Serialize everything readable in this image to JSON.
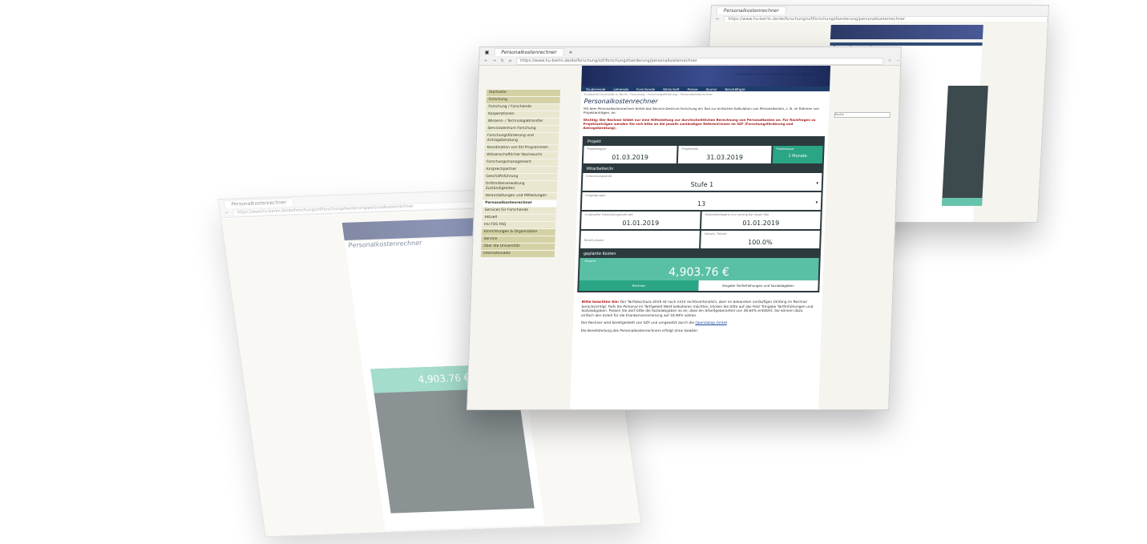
{
  "browser": {
    "tab_title": "Personalkostenrechner",
    "url": "https://www.hu-berlin.de/de/forschung/szf/forschungsfoerderung/personalkostenrechner"
  },
  "site": {
    "university_name": "HUMBOLDT-UNIVERSITÄT ZU BERLIN",
    "top_nav": [
      "Studierende",
      "Lehrende",
      "Forschende",
      "Wirtschaft",
      "Presse",
      "Alumni",
      "Beschäftigte"
    ],
    "breadcrumb": "Humboldt-Universität zu Berlin › Forschung › Forschungsförderung › Personalkostenrechner",
    "search_placeholder": "Suche"
  },
  "sidebar": {
    "items": [
      "Startseite",
      "Forschung",
      "Forschung / Forschende",
      "Kooperationen",
      "Wissens- / Technologietransfer",
      "Servicezentrum Forschung",
      "Forschungsförderung und Antragsberatung",
      "Koordination von EU-Programmen",
      "Wissenschaftlicher Nachwuchs",
      "Forschungsmanagement",
      "Ansprechpartner",
      "Geschäftsführung",
      "Drittmittelverwaltung Zuständigkeiten",
      "Veranstaltungen und Mitteilungen",
      "Personalkostenrechner",
      "Services für Forschende",
      "Aktuell",
      "HU FDS FAQ",
      "Einrichtungen & Organisation",
      "Service",
      "Über die Universität",
      "Internationales"
    ]
  },
  "main": {
    "page_title": "Personalkostenrechner",
    "intro": "Mit dem Personalkostenrechner bietet das Service-Zentrum Forschung ein Tool zur einfachen Kalkulation von Personalkosten, z. B. im Rahmen von Projektanträgen, an.",
    "warning": "Wichtig: Der Rechner bildet nur eine Hilfsstellung zur durchschnittlichen Berechnung von Personalkosten an. Für Rückfragen zu Projektanträgen wenden Sie sich bitte an die jeweils zuständigen Referent/innen im SZF (Forschungsförderung und Antragsberatung)."
  },
  "calculator": {
    "section_project": "Projekt",
    "project_start_label": "Projektbeginn",
    "project_start": "01.03.2019",
    "project_end_label": "Projektende",
    "project_end": "31.03.2019",
    "duration_label": "Projektdauer",
    "duration": "1 Monate",
    "section_staff": "Mitarbeiter/in",
    "level_label": "Entwicklungsstufe",
    "level": "Stufe 1",
    "group_label": "Entgeltgruppe",
    "group": "13",
    "level_since_label": "In aktueller Entwicklungsstufe seit",
    "level_since": "01.01.2019",
    "staff_start_label": "Mitarbeiterbeginn (nur wichtig bei neuen MA)",
    "staff_start": "01.01.2019",
    "parttime_label": "Teilzeit planen",
    "fulltime_label": "Vollzeit / Teilzeit",
    "fulltime": "100.0%",
    "section_costs": "geplante Kosten",
    "total_label": "Gesamt",
    "total": "4,903.76 €",
    "tab_calculator": "Rechner",
    "tab_input": "Eingabe Tariferhöhungen und Sozialabgaben"
  },
  "notes": {
    "note_bold": "Bitte beachten Sie:",
    "note_text": "Der Tarifabschluss 2019 ist noch nicht rechtsverbindlich, aber im bekannten vorläufigen Umfang im Rechner berücksichtigt. Falls Sie Personal im Tarifgebiet West kalkulieren möchten, klicken Sie bitte auf das Feld \"Eingabe Tariferhöhungen und Sozialabgaben. Passen Sie dort bitte die Sozialabgaben so an, dass ein Arbeitgeberanteil von 38,64% entsteht. Sie können dazu einfach den Anteil für die Krankenversicherung auf 18,94% setzen.",
    "provided_prefix": "Der Rechner wird bereitgestellt von SZF und umgesetzt durch die",
    "provided_link": "Opendukap GmbH",
    "disclaimer": "Die Bereitstellung des Personalkostenrechners erfolgt ohne Gewähr."
  }
}
